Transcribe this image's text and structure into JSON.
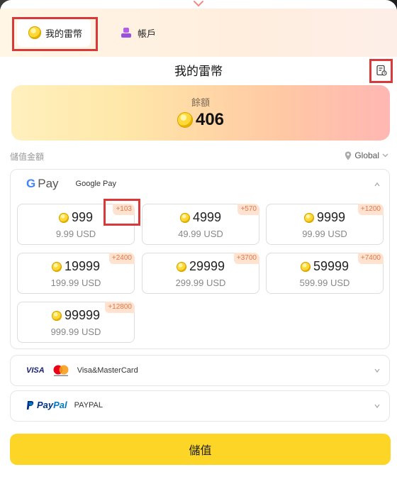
{
  "tabs": [
    {
      "label": "我的雷幣",
      "icon": "coin-icon",
      "active": true
    },
    {
      "label": "帳戶",
      "icon": "user-icon",
      "active": false
    }
  ],
  "page_title": "我的雷幣",
  "balance": {
    "label": "餘額",
    "value": "406"
  },
  "section_label": "儲值金額",
  "region": "Global",
  "payment_methods": {
    "google_pay": {
      "name": "Google Pay",
      "logo": "G Pay",
      "packages": [
        {
          "amount": "999",
          "price": "9.99 USD",
          "bonus": "+103"
        },
        {
          "amount": "4999",
          "price": "49.99 USD",
          "bonus": "+570"
        },
        {
          "amount": "9999",
          "price": "99.99 USD",
          "bonus": "+1200"
        },
        {
          "amount": "19999",
          "price": "199.99 USD",
          "bonus": "+2400"
        },
        {
          "amount": "29999",
          "price": "299.99 USD",
          "bonus": "+3700"
        },
        {
          "amount": "59999",
          "price": "599.99 USD",
          "bonus": "+7400"
        },
        {
          "amount": "99999",
          "price": "999.99 USD",
          "bonus": "+12800"
        }
      ]
    },
    "visa": {
      "name": "Visa&MasterCard",
      "logo": "VISA"
    },
    "paypal": {
      "name": "PAYPAL",
      "logo_pay": "Pay",
      "logo_pal": "Pal"
    }
  },
  "submit_label": "儲值",
  "colors": {
    "accent": "#fdd526",
    "highlight": "#d83a3a",
    "bonus": "#e07a4a"
  }
}
